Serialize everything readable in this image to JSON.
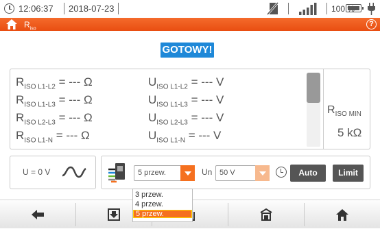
{
  "status_bar": {
    "time": "12:06:37",
    "date": "2018-07-23",
    "battery_percent": "100 %"
  },
  "header": {
    "title_main": "R",
    "title_sub": "iso"
  },
  "status_badge": "GOTOWY!",
  "results": [
    {
      "r_sym": "R",
      "r_sub": "ISO L1-L2",
      "r_val": " = --- Ω",
      "u_sym": "U",
      "u_sub": "ISO L1-L2",
      "u_val": " = --- V"
    },
    {
      "r_sym": "R",
      "r_sub": "ISO L1-L3",
      "r_val": " = --- Ω",
      "u_sym": "U",
      "u_sub": "ISO L1-L3",
      "u_val": " = --- V"
    },
    {
      "r_sym": "R",
      "r_sub": "ISO L2-L3",
      "r_val": " = --- Ω",
      "u_sym": "U",
      "u_sub": "ISO L2-L3",
      "u_val": " = --- V"
    },
    {
      "r_sym": "R",
      "r_sub": "ISO L1-N",
      "r_val": " = --- Ω",
      "u_sym": "U",
      "u_sub": "ISO L1-N",
      "u_val": " = --- V"
    }
  ],
  "rmin": {
    "sym": "R",
    "sub": "ISO MIN",
    "value": "5 kΩ"
  },
  "voltage": {
    "label": "U = 0 V",
    "icon": "sine-wave-icon"
  },
  "settings": {
    "wires_value": "5 przew.",
    "un_label": "Un",
    "un_value": "50 V",
    "auto_label": "Auto",
    "limit_label": "Limit"
  },
  "dropdown_options": [
    "3 przew.",
    "4 przew.",
    "5 przew."
  ],
  "dropdown_selected": "5 przew.",
  "colors": {
    "accent_orange": "#f05a1e",
    "badge_blue": "#1e88d8",
    "button_dark": "#555555"
  },
  "toolbar_icons": [
    "arrow-left-icon",
    "download-box-icon",
    "export-icon",
    "memory-save-icon",
    "home-icon"
  ]
}
